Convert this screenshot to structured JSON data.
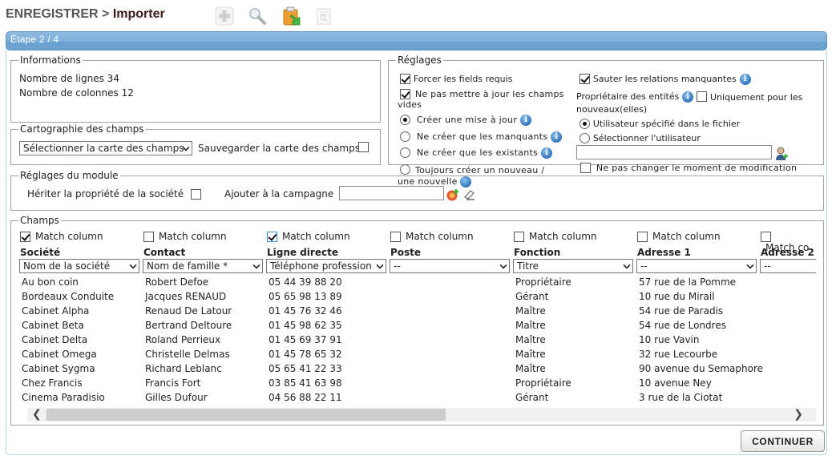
{
  "header": {
    "breadcrumb_parent": "ENREGISTRER",
    "breadcrumb_sep": ">",
    "breadcrumb_current": "Importer",
    "toolbar_icons": [
      "add-icon",
      "search-icon",
      "import-clipboard-icon",
      "preview-document-icon"
    ]
  },
  "step": {
    "label": "Étape 2 / 4"
  },
  "informations": {
    "legend": "Informations",
    "rows_label": "Nombre de lignes 34",
    "cols_label": "Nombre de colonnes 12"
  },
  "cartographie": {
    "legend": "Cartographie des champs",
    "select_value": "Sélectionner la carte des champs",
    "save_label": "Sauvegarder la carte des champs",
    "save_checked": false
  },
  "reglages": {
    "legend": "Réglages",
    "force_required": {
      "label": "Forcer les fields requis",
      "checked": true
    },
    "no_update_empty": {
      "label": "Ne pas mettre à jour les champs vides",
      "checked": true
    },
    "mode_options": [
      {
        "label": "Créer une mise à jour",
        "selected": true,
        "info": true
      },
      {
        "label": "Ne créer que les manquants",
        "selected": false,
        "info": true
      },
      {
        "label": "Ne créer que les existants",
        "selected": false,
        "info": true
      },
      {
        "label": "Toujours créer un nouveau / une nouvelle",
        "selected": false,
        "info": true
      }
    ],
    "skip_relations": {
      "label": "Sauter les relations manquantes",
      "checked": true
    },
    "owner_label": "Propriétaire des entités",
    "only_new": {
      "label": "Uniquement pour les nouveaux(elles)",
      "checked": false
    },
    "owner_options": [
      {
        "label": "Utilisateur spécifié dans le fichier",
        "selected": true
      },
      {
        "label": "Sélectionner l'utilisateur",
        "selected": false
      }
    ],
    "user_input_value": "",
    "no_change_modif": {
      "label": "Ne pas changer le moment de modification",
      "checked": false
    }
  },
  "module": {
    "legend": "Réglages du module",
    "inherit_label": "Hériter la propriété de la société",
    "inherit_checked": false,
    "campaign_label": "Ajouter à la campagne",
    "campaign_value": ""
  },
  "champs": {
    "legend": "Champs",
    "match_label": "Match column",
    "match_label_cut": "Match co",
    "columns": [
      {
        "header": "Société",
        "mapping": "Nom de la société",
        "matched": true
      },
      {
        "header": "Contact",
        "mapping": "Nom de famille *",
        "matched": false
      },
      {
        "header": "Ligne directe",
        "mapping": "Téléphone profession",
        "matched": true
      },
      {
        "header": "Poste",
        "mapping": "--",
        "matched": false
      },
      {
        "header": "Fonction",
        "mapping": "Titre",
        "matched": false
      },
      {
        "header": "Adresse 1",
        "mapping": "--",
        "matched": false
      },
      {
        "header": "Adresse 2",
        "mapping": "--",
        "matched": false
      }
    ],
    "rows": [
      [
        "Au bon coin",
        "Robert Defoe",
        "05 44 39 88 20",
        "",
        "Propriétaire",
        "57 rue de la Pomme",
        ""
      ],
      [
        "Bordeaux Conduite",
        "Jacques RENAUD",
        "05 65 98 13 89",
        "",
        "Gérant",
        "10 rue du Mirail",
        ""
      ],
      [
        "Cabinet Alpha",
        "Renaud De Latour",
        "01 45 76 32 46",
        "",
        "Maître",
        "54 rue de Paradis",
        ""
      ],
      [
        "Cabinet Beta",
        "Bertrand Deltoure",
        "01 45 98 62 35",
        "",
        "Maître",
        "54 rue de Londres",
        ""
      ],
      [
        "Cabinet Delta",
        "Roland Perrieux",
        "01 45 69 37 91",
        "",
        "Maître",
        "10 rue Vavin",
        ""
      ],
      [
        "Cabinet Omega",
        "Christelle Delmas",
        "01 45 78 65 32",
        "",
        "Maître",
        "32 rue Lecourbe",
        ""
      ],
      [
        "Cabinet Sygma",
        "Richard Leblanc",
        "05 65 41 22 33",
        "",
        "Maître",
        "90 avenue du Semaphore",
        ""
      ],
      [
        "Chez Francis",
        "Francis Fort",
        "03 85 41 63 98",
        "",
        "Propriétaire",
        "10 avenue Ney",
        ""
      ],
      [
        "Cinema Paradisio",
        "Gilles Dufour",
        "04 56 88 22 11",
        "",
        "Gérant",
        "3 rue de la Ciotat",
        ""
      ]
    ]
  },
  "scrollbar": {
    "left_arrow": "❮",
    "right_arrow": "❯"
  },
  "footer": {
    "continue_label": "CONTINUER"
  },
  "colors": {
    "step_bar": "#7db0da",
    "info_icon": "#2f74bd",
    "panel_border": "#b4d4e4"
  }
}
